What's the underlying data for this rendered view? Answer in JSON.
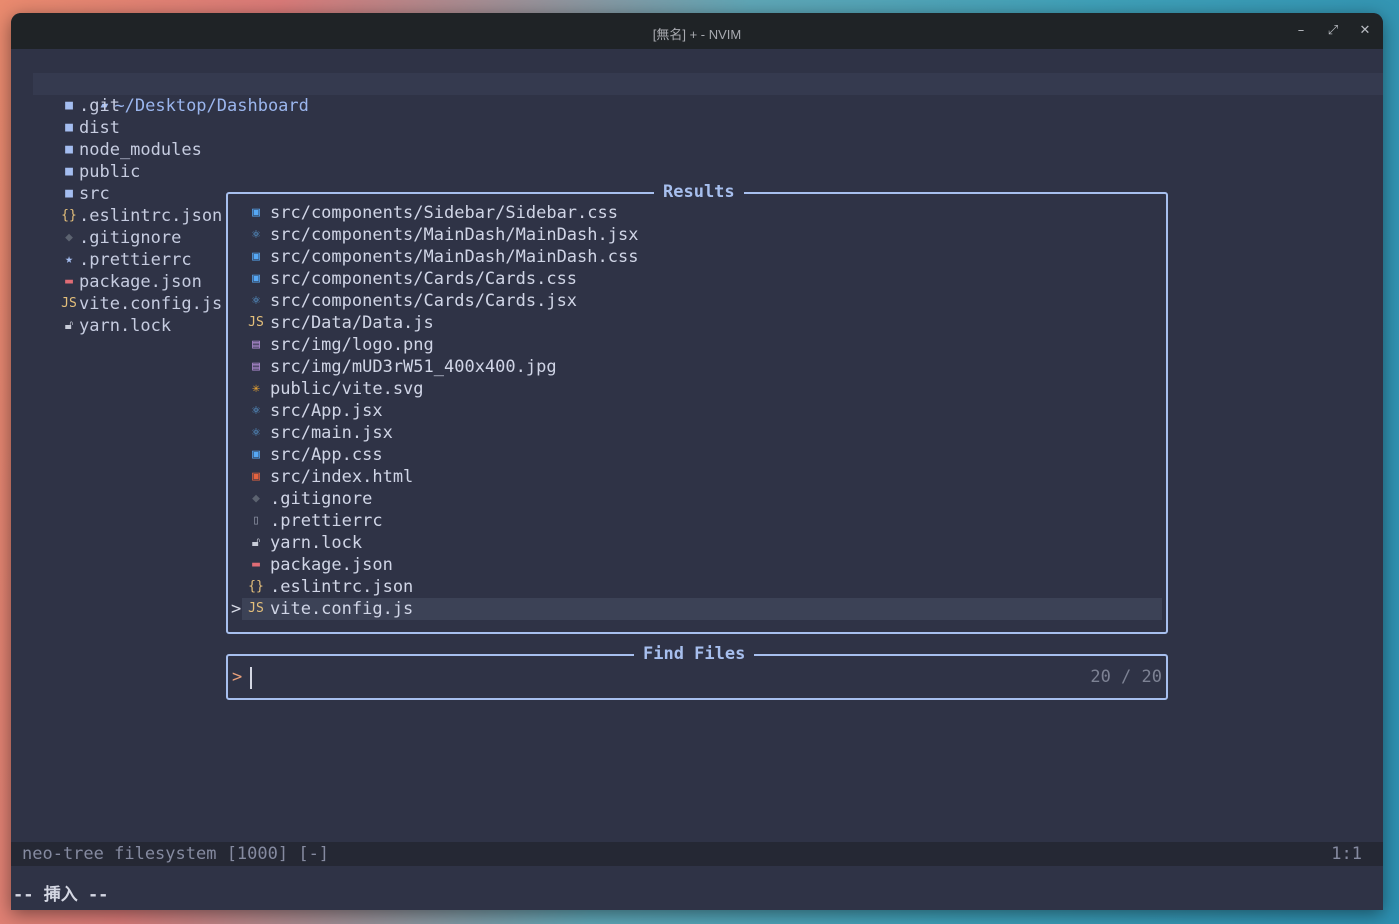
{
  "window": {
    "title": "[無名] + - NVIM",
    "minimize_glyph": "–",
    "maximize_glyph": "⤢",
    "close_glyph": "✕"
  },
  "tree": {
    "root": "~/Desktop/Dashboard",
    "items": [
      {
        "name": ".git",
        "icon": "folder-icon",
        "glyph": "■",
        "color": "#a4bdf0"
      },
      {
        "name": "dist",
        "icon": "folder-icon",
        "glyph": "■",
        "color": "#a4bdf0"
      },
      {
        "name": "node_modules",
        "icon": "folder-icon",
        "glyph": "■",
        "color": "#a4bdf0"
      },
      {
        "name": "public",
        "icon": "folder-icon",
        "glyph": "■",
        "color": "#a4bdf0"
      },
      {
        "name": "src",
        "icon": "folder-icon",
        "glyph": "■",
        "color": "#a4bdf0"
      },
      {
        "name": ".eslintrc.json",
        "icon": "json-icon",
        "glyph": "{}",
        "color": "#e5c07b"
      },
      {
        "name": ".gitignore",
        "icon": "git-icon",
        "glyph": "◆",
        "color": "#5c6370"
      },
      {
        "name": ".prettierrc",
        "icon": "star-icon",
        "glyph": "★",
        "color": "#a4bdf0"
      },
      {
        "name": "package.json",
        "icon": "npm-icon",
        "glyph": "▬",
        "color": "#e06c75"
      },
      {
        "name": "vite.config.js",
        "icon": "js-icon",
        "glyph": "JS",
        "color": "#e5c07b"
      },
      {
        "name": "yarn.lock",
        "icon": "lock-icon",
        "glyph": "🔓︎",
        "color": "#c8ccd8"
      }
    ]
  },
  "results": {
    "title": "Results",
    "items": [
      {
        "path": "src/components/Sidebar/Sidebar.css",
        "icon": "css-icon",
        "glyph": "▣",
        "color": "#56a8f5"
      },
      {
        "path": "src/components/MainDash/MainDash.jsx",
        "icon": "react-icon",
        "glyph": "⚛",
        "color": "#61afef"
      },
      {
        "path": "src/components/MainDash/MainDash.css",
        "icon": "css-icon",
        "glyph": "▣",
        "color": "#56a8f5"
      },
      {
        "path": "src/components/Cards/Cards.css",
        "icon": "css-icon",
        "glyph": "▣",
        "color": "#56a8f5"
      },
      {
        "path": "src/components/Cards/Cards.jsx",
        "icon": "react-icon",
        "glyph": "⚛",
        "color": "#61afef"
      },
      {
        "path": "src/Data/Data.js",
        "icon": "js-icon",
        "glyph": "JS",
        "color": "#e5c07b"
      },
      {
        "path": "src/img/logo.png",
        "icon": "image-icon",
        "glyph": "▤",
        "color": "#b58fd8"
      },
      {
        "path": "src/img/mUD3rW51_400x400.jpg",
        "icon": "image-icon",
        "glyph": "▤",
        "color": "#b58fd8"
      },
      {
        "path": "public/vite.svg",
        "icon": "svg-icon",
        "glyph": "✳",
        "color": "#f0a830"
      },
      {
        "path": "src/App.jsx",
        "icon": "react-icon",
        "glyph": "⚛",
        "color": "#61afef"
      },
      {
        "path": "src/main.jsx",
        "icon": "react-icon",
        "glyph": "⚛",
        "color": "#61afef"
      },
      {
        "path": "src/App.css",
        "icon": "css-icon",
        "glyph": "▣",
        "color": "#56a8f5"
      },
      {
        "path": "src/index.html",
        "icon": "html-icon",
        "glyph": "▣",
        "color": "#e5633f"
      },
      {
        "path": ".gitignore",
        "icon": "git-icon",
        "glyph": "◆",
        "color": "#5c6370"
      },
      {
        "path": ".prettierrc",
        "icon": "file-icon",
        "glyph": "▯",
        "color": "#8a8fa0"
      },
      {
        "path": "yarn.lock",
        "icon": "lock-icon",
        "glyph": "🔓︎",
        "color": "#c8ccd8"
      },
      {
        "path": "package.json",
        "icon": "npm-icon",
        "glyph": "▬",
        "color": "#e06c75"
      },
      {
        "path": ".eslintrc.json",
        "icon": "json-icon",
        "glyph": "{}",
        "color": "#e5c07b"
      },
      {
        "path": "vite.config.js",
        "icon": "js-icon",
        "glyph": "JS",
        "color": "#e5c07b",
        "selected": true
      }
    ],
    "selection_caret": ">"
  },
  "find": {
    "title": "Find Files",
    "prompt": ">",
    "count": "20 / 20"
  },
  "statusline": {
    "left": "neo-tree filesystem [1000] [-]",
    "right": "1:1"
  },
  "cmdline": "-- 挿入 --"
}
